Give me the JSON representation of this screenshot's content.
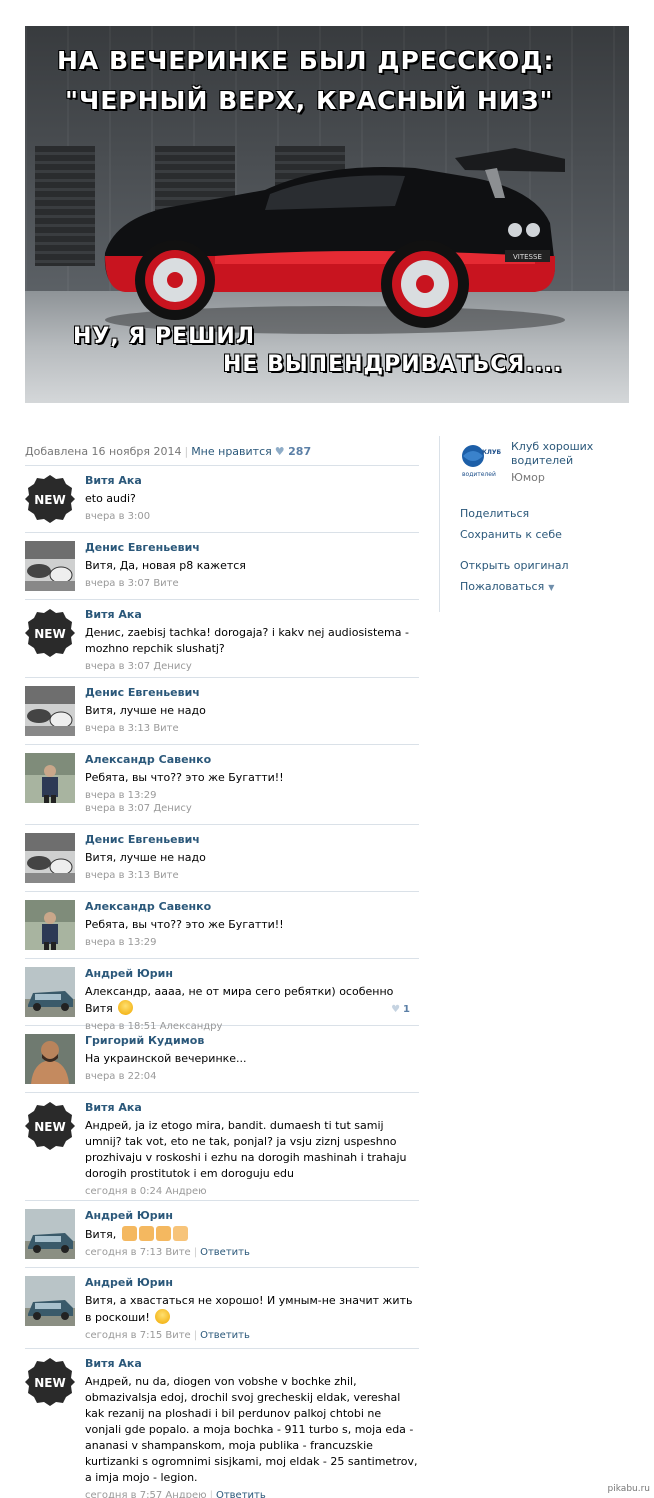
{
  "hero": {
    "line1": "НА ВЕЧЕРИНКЕ БЫЛ ДРЕССКОД:",
    "line2": "\"ЧЕРНЫЙ ВЕРХ, КРАСНЫЙ НИЗ\"",
    "line3": "НУ, Я РЕШИЛ",
    "line4": "НЕ ВЫПЕНДРИВАТЬСЯ....",
    "car_plate": "VITESSE"
  },
  "meta": {
    "added": "Добавлена 16 ноября 2014",
    "like_label": "Мне нравится",
    "heart": "♥",
    "like_count": "287"
  },
  "avatar_badge": "NEW",
  "comments": [
    {
      "author": "Витя Ака",
      "text": "eto audi?",
      "time": "вчера в 3:00"
    },
    {
      "author": "Денис Евгеньевич",
      "text": "Витя, Да, новая р8 кажется",
      "time": "вчера в 3:07 Вите"
    },
    {
      "author": "Витя Ака",
      "text": "Денис, zaebisj tachka! dorogaja? i kakv nej audiosistema - mozhno repchik slushatj?",
      "time": "вчера в 3:07 Денису"
    },
    {
      "author": "Денис Евгеньевич",
      "text": "Витя, лучше не надо",
      "time": "вчера в 3:13 Вите"
    },
    {
      "author": "Александр Савенко",
      "text": "Ребята, вы что?? это же Бугатти!!",
      "time": "вчера в 13:29",
      "time2": "вчера в 3:07 Денису"
    },
    {
      "author": "Денис Евгеньевич",
      "text": "Витя, лучше не надо",
      "time": "вчера в 3:13 Вите"
    },
    {
      "author": "Александр Савенко",
      "text": "Ребята, вы что?? это же Бугатти!!",
      "time": "вчера в 13:29"
    },
    {
      "author": "Андрей Юрин",
      "text": "Александр, аааа, не от мира сего ребятки) особенно Витя",
      "time": "вчера в 18:51 Александру",
      "likes": "1"
    },
    {
      "author": "Григорий Кудимов",
      "text": "На украинской вечеринке...",
      "time": "вчера в 22:04"
    },
    {
      "author": "Витя Ака",
      "text": "Андрей, ja iz etogo mira, bandit. dumaesh ti tut samij umnij? tak vot, eto ne tak, ponjal? ja vsju ziznj uspeshno prozhivaju v roskoshi i ezhu na dorogih mashinah i trahaju dorogih prostitutok i em doroguju edu",
      "time": "сегодня в 0:24 Андрею"
    },
    {
      "author": "Андрей Юрин",
      "text": "Витя,",
      "time": "сегодня в 7:13 Вите",
      "reply": "Ответить"
    },
    {
      "author": "Андрей Юрин",
      "text": "Витя, а хвастаться не хорошо! И умным-не значит жить в роскоши!",
      "time": "сегодня в 7:15 Вите",
      "reply": "Ответить"
    },
    {
      "author": "Витя Ака",
      "text": "Андрей, nu da, diogen von vobshe v bochke zhil, obmazivalsja edoj, drochil svoj grecheskij eldak, vereshal kak rezanij na ploshadi i bil perdunov palkoj chtobi ne vonjali gde popalo. a moja bochka - 911 turbo s, moja eda - ananasi v shampanskom, moja publika - francuzskie kurtizanki s ogromnimi sisjkami, moj eldak - 25 santimetrov, a imja mojo - legion.",
      "time": "сегодня в 7:57 Андрею",
      "reply": "Ответить"
    }
  ],
  "sidebar": {
    "group_logo_text": "КЛУБ хороших водителей",
    "group_name": "Клуб хороших водителей",
    "category": "Юмор",
    "share": "Поделиться",
    "save": "Сохранить к себе",
    "open_original": "Открыть оригинал",
    "report": "Пожаловаться",
    "report_arrow": "▼"
  },
  "watermark": "pikabu.ru",
  "colors": {
    "link": "#2b587a",
    "muted": "#999999",
    "divider": "#dae1e8",
    "car_red": "#d4202a"
  }
}
